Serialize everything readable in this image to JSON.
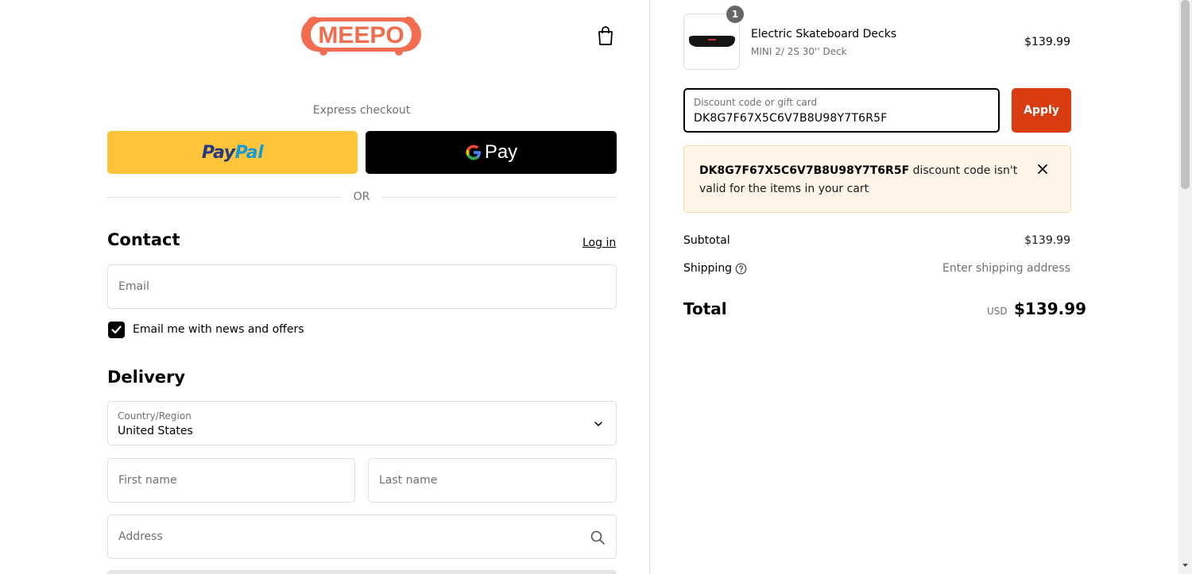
{
  "header": {
    "logo_text": "MEEPO",
    "cart_icon": "shopping-bag-icon"
  },
  "express": {
    "label": "Express checkout",
    "paypal_label_1": "Pay",
    "paypal_label_2": "Pal",
    "gpay_label": "Pay",
    "or_label": "OR"
  },
  "contact": {
    "heading": "Contact",
    "login_label": "Log in",
    "email_placeholder": "Email",
    "newsletter_label": "Email me with news and offers",
    "newsletter_checked": true
  },
  "delivery": {
    "heading": "Delivery",
    "country_label": "Country/Region",
    "country_value": "United States",
    "first_name_placeholder": "First name",
    "last_name_placeholder": "Last name",
    "address_placeholder": "Address"
  },
  "order": {
    "item": {
      "quantity": "1",
      "title": "Electric Skateboard Decks",
      "variant": "MINI 2/ 2S 30'' Deck",
      "price": "$139.99"
    },
    "discount": {
      "label": "Discount code or gift card",
      "value": "DK8G7F67X5C6V7B8U98Y7T6R5F",
      "apply_label": "Apply"
    },
    "alert": {
      "code": "DK8G7F67X5C6V7B8U98Y7T6R5F",
      "message": " discount code isn't valid for the items in your cart"
    },
    "subtotal_label": "Subtotal",
    "subtotal_value": "$139.99",
    "shipping_label": "Shipping",
    "shipping_value": "Enter shipping address",
    "total_label": "Total",
    "total_currency": "USD",
    "total_value": "$139.99"
  },
  "colors": {
    "brand": "#f26c4f",
    "apply_button": "#d93c10",
    "paypal_yellow": "#ffc439",
    "alert_bg": "#fff4e8"
  }
}
